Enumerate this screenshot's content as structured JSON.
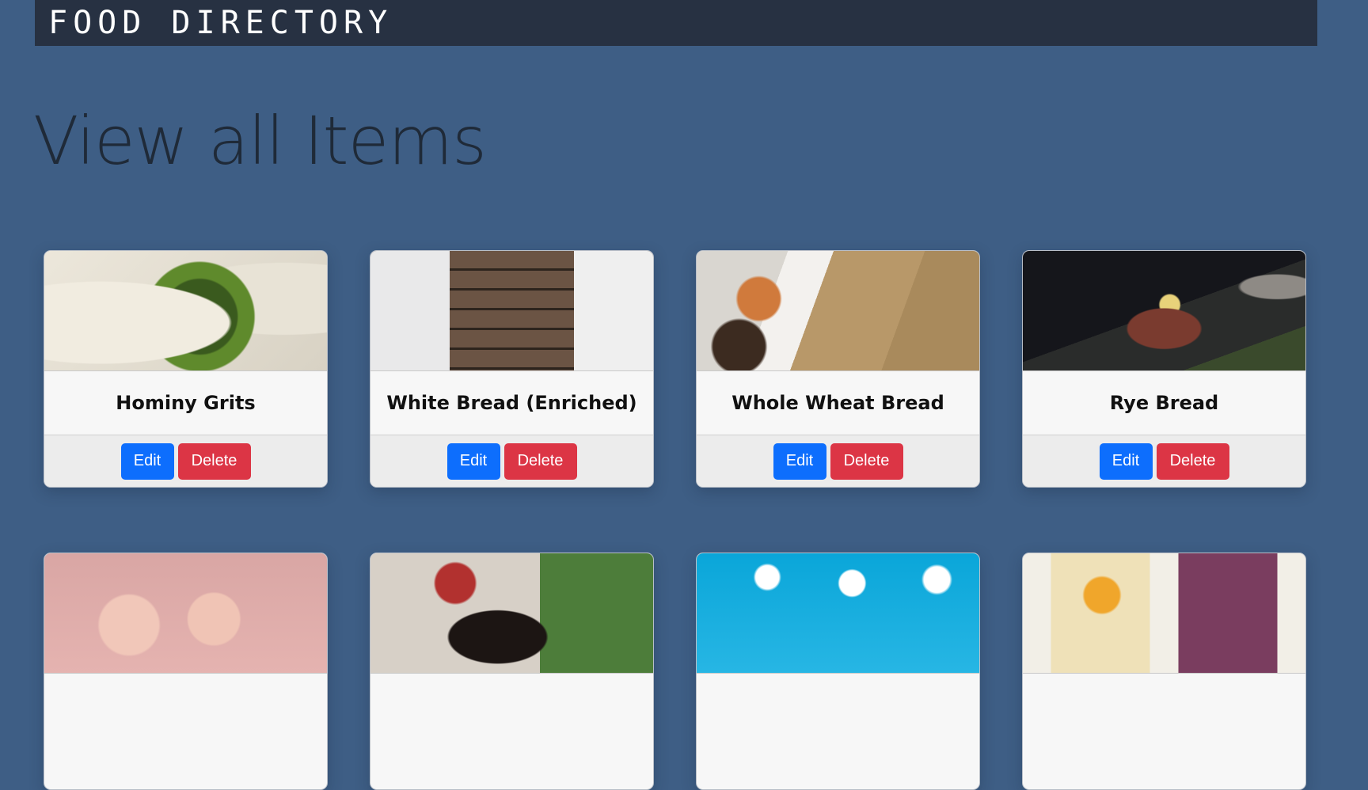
{
  "navbar": {
    "brand": "FOOD DIRECTORY"
  },
  "page": {
    "title": "View all Items"
  },
  "items": [
    {
      "name": "Hominy Grits",
      "image_icon": "photo-collard-greens-grits",
      "edit_label": "Edit",
      "delete_label": "Delete"
    },
    {
      "name": "White Bread (Enriched)",
      "image_icon": "photo-sliced-bread",
      "edit_label": "Edit",
      "delete_label": "Delete"
    },
    {
      "name": "Whole Wheat Bread",
      "image_icon": "photo-scones",
      "edit_label": "Edit",
      "delete_label": "Delete"
    },
    {
      "name": "Rye Bread",
      "image_icon": "photo-open-sandwich",
      "edit_label": "Edit",
      "delete_label": "Delete"
    },
    {
      "name": "",
      "image_icon": "photo-cupcakes",
      "edit_label": "",
      "delete_label": ""
    },
    {
      "name": "",
      "image_icon": "photo-woman-drinking",
      "edit_label": "",
      "delete_label": ""
    },
    {
      "name": "",
      "image_icon": "photo-blue-sky-clouds",
      "edit_label": "",
      "delete_label": ""
    },
    {
      "name": "",
      "image_icon": "photo-smoothies",
      "edit_label": "",
      "delete_label": ""
    }
  ],
  "colors": {
    "page_background": "#3e5e85",
    "navbar_background": "#273142",
    "edit_button": "#0d6efd",
    "delete_button": "#dc3545"
  }
}
